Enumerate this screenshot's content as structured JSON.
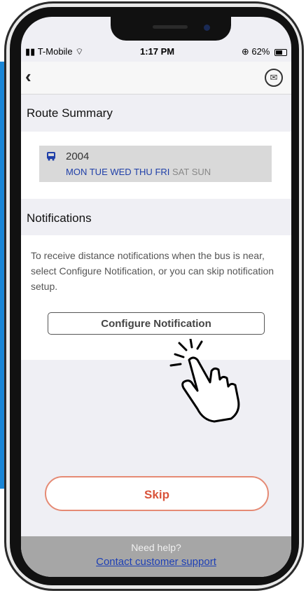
{
  "status_bar": {
    "carrier": "T-Mobile",
    "time": "1:17 PM",
    "battery": "62%"
  },
  "header": {
    "back_icon": "chevron-left-icon",
    "mail_icon": "mail-icon"
  },
  "route_summary": {
    "title": "Route Summary",
    "route_number": "2004",
    "days_active": [
      "MON",
      "TUE",
      "WED",
      "THU",
      "FRI"
    ],
    "days_inactive": [
      "SAT",
      "SUN"
    ]
  },
  "notifications": {
    "title": "Notifications",
    "description": "To receive distance notifications when the bus is near, select Configure Notification, or you can skip notification setup.",
    "configure_label": "Configure Notification"
  },
  "actions": {
    "skip_label": "Skip"
  },
  "footer": {
    "help_text": "Need help?",
    "contact_link": "Contact customer support"
  },
  "colors": {
    "link_blue": "#1f3fa8",
    "skip_red": "#d9533a",
    "skip_border": "#e58a74",
    "side_bar": "#1a86d6"
  }
}
